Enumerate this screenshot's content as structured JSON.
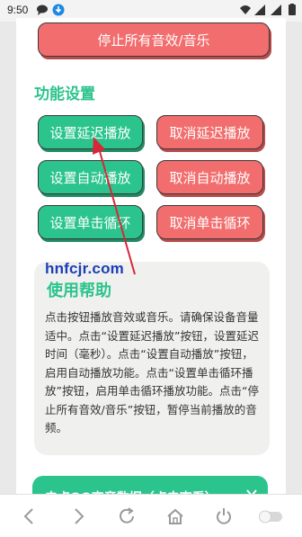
{
  "status_bar": {
    "time": "9:50"
  },
  "buttons": {
    "stop_all": "停止所有音效/音乐",
    "set_delay": "设置延迟播放",
    "cancel_delay": "取消延迟播放",
    "set_auto": "设置自动播放",
    "cancel_auto": "取消自动播放",
    "set_loop": "设置单击循环",
    "cancel_loop": "取消单击循环"
  },
  "section_title": "功能设置",
  "help": {
    "watermark": "hnfcjr.com",
    "title": "使用帮助",
    "text": "点击按钮播放音效或音乐。请确保设备音量适中。点击“设置延迟播放”按钮，设置延迟时间（毫秒）。点击“设置自动播放”按钮，启用自动播放功能。点击“设置单击循环播放”按钮，启用单击循环播放功能。点击“停止所有音效/音乐”按钮，暂停当前播放的音频。"
  },
  "bottom_banner": {
    "label": "电点QQ变音数据（点击查看）"
  },
  "colors": {
    "green": "#2bc48c",
    "red": "#f26d6d",
    "watermark": "#1a3fb8",
    "arrow": "#d6283a"
  },
  "icons": {
    "status": [
      "chat-bubble-icon",
      "download-icon",
      "wifi-icon",
      "signal-icon",
      "signal-icon-2",
      "battery-icon"
    ],
    "nav": [
      "back-icon",
      "forward-icon",
      "refresh-icon",
      "home-icon",
      "power-icon",
      "toggle-icon"
    ]
  }
}
